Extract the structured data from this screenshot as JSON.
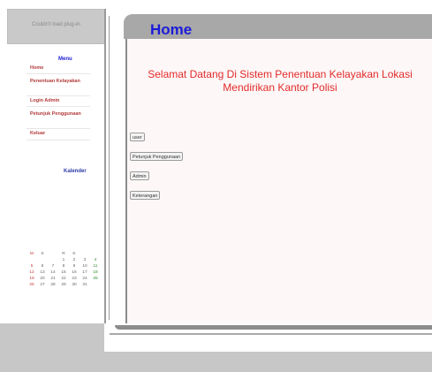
{
  "plugin_message": "Couldn't load plug-in.",
  "menu": {
    "title": "Menu",
    "items": [
      {
        "label": "Home"
      },
      {
        "label": "Penentuan Kelayakan"
      },
      {
        "label": "Login Admin"
      },
      {
        "label": "Petunjuk Penggunaan"
      },
      {
        "label": "Keluar"
      }
    ]
  },
  "calendar": {
    "title": "Kalender",
    "headers": [
      "M",
      "S",
      "",
      "R",
      "K",
      "",
      ""
    ],
    "rows": [
      [
        "",
        "",
        "",
        "",
        "1",
        "2",
        "3",
        "4"
      ],
      [
        "5",
        "6",
        "7",
        "8",
        "9",
        "10",
        "11"
      ],
      [
        "12",
        "13",
        "14",
        "15",
        "16",
        "17",
        "18"
      ],
      [
        "19",
        "20",
        "21",
        "22",
        "23",
        "24",
        "25"
      ],
      [
        "26",
        "27",
        "28",
        "29",
        "30",
        "31",
        ""
      ]
    ]
  },
  "header": {
    "title": "Home"
  },
  "main": {
    "welcome_line1": "Selamat Datang Di Sistem Penentuan Kelayakan Lokasi",
    "welcome_line2": "Mendirikan Kantor Polisi",
    "buttons": [
      {
        "label": "user"
      },
      {
        "label": "Petunjuk Penggunaan"
      },
      {
        "label": "Admin"
      },
      {
        "label": "Keterangan"
      }
    ]
  }
}
